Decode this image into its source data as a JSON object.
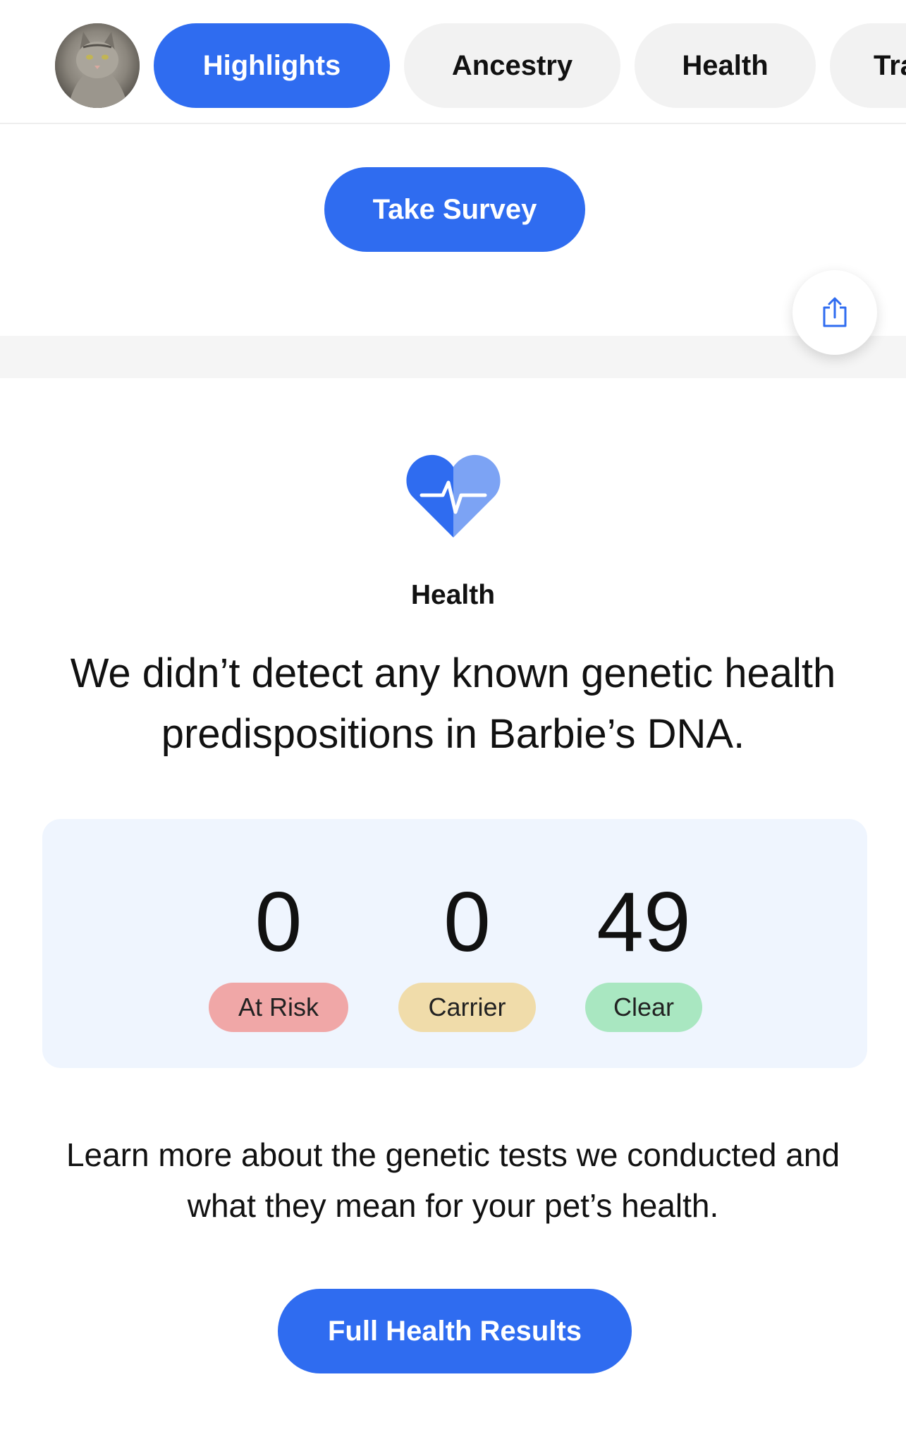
{
  "tabs": [
    {
      "label": "Highlights",
      "active": true
    },
    {
      "label": "Ancestry",
      "active": false
    },
    {
      "label": "Health",
      "active": false
    },
    {
      "label": "Tra",
      "active": false
    }
  ],
  "survey": {
    "button_label": "Take Survey"
  },
  "share": {
    "icon": "share-icon"
  },
  "health": {
    "icon": "heart-pulse-icon",
    "section_label": "Health",
    "headline": "We didn’t detect any known genetic health predispositions in Barbie’s DNA.",
    "stats": [
      {
        "count": "0",
        "label": "At Risk",
        "color": "#f0a7a7"
      },
      {
        "count": "0",
        "label": "Carrier",
        "color": "#f0dcaa"
      },
      {
        "count": "49",
        "label": "Clear",
        "color": "#a9e7c1"
      }
    ],
    "learn_more": "Learn more about the genetic tests we conducted and what they mean for your pet’s health.",
    "results_button_label": "Full Health Results"
  },
  "colors": {
    "accent": "#2f6cf0",
    "card_background": "#eff5fe"
  }
}
